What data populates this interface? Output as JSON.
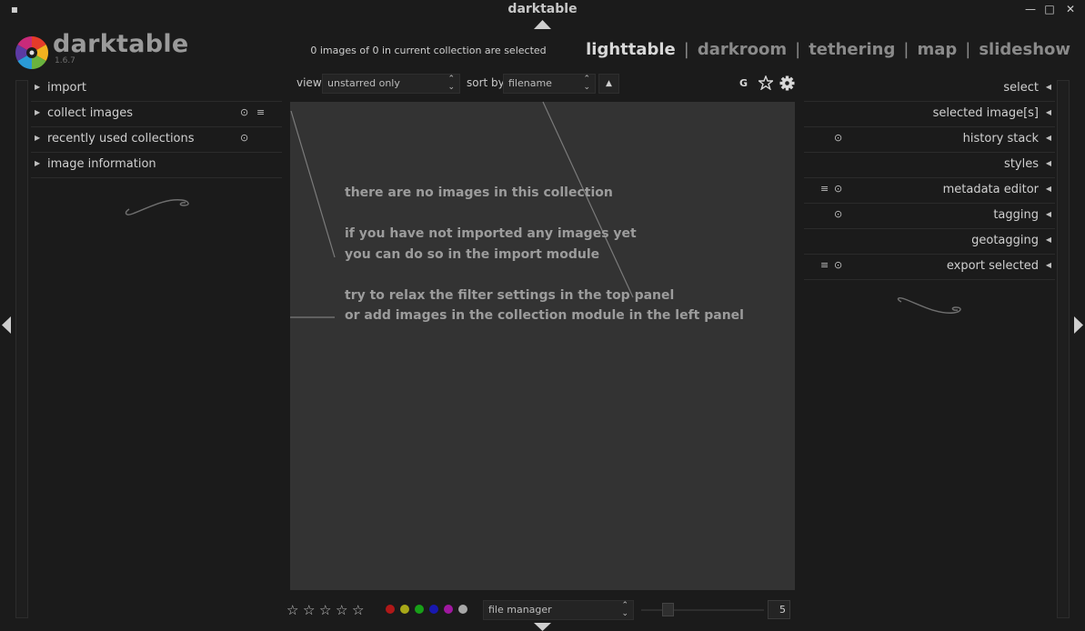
{
  "window": {
    "title": "darktable",
    "close_glyph": "✕",
    "maximize_glyph": "□",
    "minimize_glyph": "—",
    "menu_glyph": "▪"
  },
  "logo": {
    "name": "darktable",
    "version": "1.6.7",
    "icon": "darktable-aperture-logo"
  },
  "header": {
    "selection_status": "0 images of 0 in current collection are selected",
    "views": [
      "lighttable",
      "darkroom",
      "tethering",
      "map",
      "slideshow"
    ],
    "view_separator": "|",
    "active_view": "lighttable"
  },
  "filter_bar": {
    "view_label": "view",
    "view_value": "unstarred only",
    "sort_label": "sort by",
    "sort_value": "filename",
    "sort_direction_glyph": "▲",
    "grouping_label": "G",
    "icons": [
      "star-icon",
      "gear-icon"
    ]
  },
  "left_panel": {
    "modules": [
      {
        "label": "import",
        "icons": []
      },
      {
        "label": "collect images",
        "icons": [
          "⊙",
          "≡"
        ]
      },
      {
        "label": "recently used collections",
        "icons": [
          "⊙"
        ]
      },
      {
        "label": "image information",
        "icons": []
      }
    ]
  },
  "right_panel": {
    "modules": [
      {
        "label": "select",
        "icons": []
      },
      {
        "label": "selected image[s]",
        "icons": []
      },
      {
        "label": "history stack",
        "icons": [
          "⊙"
        ]
      },
      {
        "label": "styles",
        "icons": []
      },
      {
        "label": "metadata editor",
        "icons": [
          "≡",
          "⊙"
        ]
      },
      {
        "label": "tagging",
        "icons": [
          "⊙"
        ]
      },
      {
        "label": "geotagging",
        "icons": []
      },
      {
        "label": "export selected",
        "icons": [
          "≡",
          "⊙"
        ]
      }
    ]
  },
  "center": {
    "messages": [
      "there are no images in this collection",
      "if you have not imported any images yet",
      "you can do so in the import module",
      "try to relax the filter settings in the top panel",
      "or add images in the collection module in the left panel"
    ]
  },
  "bottom_bar": {
    "stars": [
      "☆",
      "☆",
      "☆",
      "☆",
      "☆"
    ],
    "color_labels": [
      "#b01818",
      "#a8a818",
      "#18a018",
      "#1818b0",
      "#a018a0",
      "#a8a8a8"
    ],
    "layout_value": "file manager",
    "thumbnails_per_row": "5"
  },
  "colors": {
    "background": "#1b1b1b",
    "center": "#333333",
    "text": "#d0d0d0"
  }
}
